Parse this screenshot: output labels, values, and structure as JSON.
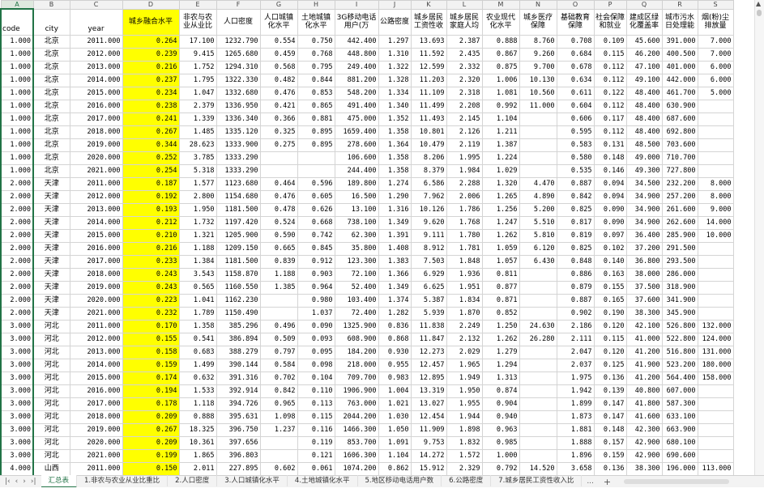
{
  "columns": [
    "A",
    "B",
    "C",
    "D",
    "E",
    "F",
    "G",
    "H",
    "I",
    "J",
    "K",
    "L",
    "M",
    "N",
    "O",
    "P",
    "Q",
    "R",
    "S"
  ],
  "headers": [
    "code",
    "city",
    "year",
    "城乡融合水平",
    "非农与农业从业比",
    "人口密度",
    "人口城镇化水平",
    "土地城镇化水平",
    "3G移动电话用户(万",
    "公路密度",
    "城乡居民工资性收",
    "城乡居民家庭人均",
    "农业现代化水平",
    "城乡医疗保障",
    "基础教育保障",
    "社会保障和就业",
    "建成区绿化覆盖率",
    "城市污水日处理能",
    "烟(粉)尘排放量"
  ],
  "rows": [
    [
      "1.000",
      "北京",
      "2011.000",
      "0.264",
      "17.100",
      "1232.790",
      "0.554",
      "0.750",
      "442.400",
      "1.297",
      "13.693",
      "2.387",
      "0.888",
      "8.760",
      "0.708",
      "0.109",
      "45.600",
      "391.000",
      "7.000"
    ],
    [
      "1.000",
      "北京",
      "2012.000",
      "0.239",
      "9.415",
      "1265.680",
      "0.459",
      "0.768",
      "448.800",
      "1.310",
      "11.592",
      "2.435",
      "0.867",
      "9.260",
      "0.684",
      "0.115",
      "46.200",
      "400.500",
      "7.000"
    ],
    [
      "1.000",
      "北京",
      "2013.000",
      "0.216",
      "1.752",
      "1294.310",
      "0.568",
      "0.795",
      "249.400",
      "1.322",
      "12.599",
      "2.332",
      "0.875",
      "9.700",
      "0.678",
      "0.112",
      "47.100",
      "401.000",
      "6.000"
    ],
    [
      "1.000",
      "北京",
      "2014.000",
      "0.237",
      "1.795",
      "1322.330",
      "0.482",
      "0.844",
      "881.200",
      "1.328",
      "11.203",
      "2.320",
      "1.006",
      "10.130",
      "0.634",
      "0.112",
      "49.100",
      "442.000",
      "6.000"
    ],
    [
      "1.000",
      "北京",
      "2015.000",
      "0.234",
      "1.047",
      "1332.680",
      "0.476",
      "0.853",
      "548.200",
      "1.334",
      "11.109",
      "2.318",
      "1.081",
      "10.560",
      "0.611",
      "0.122",
      "48.400",
      "461.700",
      "5.000"
    ],
    [
      "1.000",
      "北京",
      "2016.000",
      "0.238",
      "2.379",
      "1336.950",
      "0.421",
      "0.865",
      "491.400",
      "1.340",
      "11.499",
      "2.208",
      "0.992",
      "11.000",
      "0.604",
      "0.112",
      "48.400",
      "630.900",
      ""
    ],
    [
      "1.000",
      "北京",
      "2017.000",
      "0.241",
      "1.339",
      "1336.340",
      "0.366",
      "0.881",
      "475.000",
      "1.352",
      "11.493",
      "2.145",
      "1.104",
      "",
      "0.606",
      "0.117",
      "48.400",
      "687.600",
      ""
    ],
    [
      "1.000",
      "北京",
      "2018.000",
      "0.267",
      "1.485",
      "1335.120",
      "0.325",
      "0.895",
      "1659.400",
      "1.358",
      "10.801",
      "2.126",
      "1.211",
      "",
      "0.595",
      "0.112",
      "48.400",
      "692.800",
      ""
    ],
    [
      "1.000",
      "北京",
      "2019.000",
      "0.344",
      "28.623",
      "1333.900",
      "0.275",
      "0.895",
      "278.600",
      "1.364",
      "10.479",
      "2.119",
      "1.387",
      "",
      "0.583",
      "0.131",
      "48.500",
      "703.600",
      ""
    ],
    [
      "1.000",
      "北京",
      "2020.000",
      "0.252",
      "3.785",
      "1333.290",
      "",
      "",
      "106.600",
      "1.358",
      "8.206",
      "1.995",
      "1.224",
      "",
      "0.580",
      "0.148",
      "49.000",
      "710.700",
      ""
    ],
    [
      "1.000",
      "北京",
      "2021.000",
      "0.254",
      "5.318",
      "1333.290",
      "",
      "",
      "244.400",
      "1.358",
      "8.379",
      "1.984",
      "1.029",
      "",
      "0.535",
      "0.146",
      "49.300",
      "727.800",
      ""
    ],
    [
      "2.000",
      "天津",
      "2011.000",
      "0.187",
      "1.577",
      "1123.680",
      "0.464",
      "0.596",
      "189.800",
      "1.274",
      "6.586",
      "2.288",
      "1.320",
      "4.470",
      "0.887",
      "0.094",
      "34.500",
      "232.200",
      "8.000"
    ],
    [
      "2.000",
      "天津",
      "2012.000",
      "0.192",
      "2.800",
      "1154.680",
      "0.476",
      "0.605",
      "16.500",
      "1.290",
      "7.962",
      "2.006",
      "1.265",
      "4.890",
      "0.842",
      "0.094",
      "34.900",
      "257.200",
      "8.000"
    ],
    [
      "2.000",
      "天津",
      "2013.000",
      "0.193",
      "1.950",
      "1181.500",
      "0.478",
      "0.626",
      "13.100",
      "1.316",
      "10.126",
      "1.786",
      "1.256",
      "5.200",
      "0.825",
      "0.090",
      "34.900",
      "261.600",
      "9.000"
    ],
    [
      "2.000",
      "天津",
      "2014.000",
      "0.212",
      "1.732",
      "1197.420",
      "0.524",
      "0.668",
      "738.100",
      "1.349",
      "9.620",
      "1.768",
      "1.247",
      "5.510",
      "0.817",
      "0.090",
      "34.900",
      "262.600",
      "14.000"
    ],
    [
      "2.000",
      "天津",
      "2015.000",
      "0.210",
      "1.321",
      "1205.900",
      "0.590",
      "0.742",
      "62.300",
      "1.391",
      "9.111",
      "1.780",
      "1.262",
      "5.810",
      "0.819",
      "0.097",
      "36.400",
      "285.900",
      "10.000"
    ],
    [
      "2.000",
      "天津",
      "2016.000",
      "0.216",
      "1.188",
      "1209.150",
      "0.665",
      "0.845",
      "35.800",
      "1.408",
      "8.912",
      "1.781",
      "1.059",
      "6.120",
      "0.825",
      "0.102",
      "37.200",
      "291.500",
      ""
    ],
    [
      "2.000",
      "天津",
      "2017.000",
      "0.233",
      "1.384",
      "1181.500",
      "0.839",
      "0.912",
      "123.300",
      "1.383",
      "7.503",
      "1.848",
      "1.057",
      "6.430",
      "0.848",
      "0.140",
      "36.800",
      "293.500",
      ""
    ],
    [
      "2.000",
      "天津",
      "2018.000",
      "0.243",
      "3.543",
      "1158.870",
      "1.188",
      "0.903",
      "72.100",
      "1.366",
      "6.929",
      "1.936",
      "0.811",
      "",
      "0.886",
      "0.163",
      "38.000",
      "286.000",
      ""
    ],
    [
      "2.000",
      "天津",
      "2019.000",
      "0.243",
      "0.565",
      "1160.550",
      "1.385",
      "0.964",
      "52.400",
      "1.349",
      "6.625",
      "1.951",
      "0.877",
      "",
      "0.879",
      "0.155",
      "37.500",
      "318.900",
      ""
    ],
    [
      "2.000",
      "天津",
      "2020.000",
      "0.223",
      "1.041",
      "1162.230",
      "",
      "0.980",
      "103.400",
      "1.374",
      "5.387",
      "1.834",
      "0.871",
      "",
      "0.887",
      "0.165",
      "37.600",
      "341.900",
      ""
    ],
    [
      "2.000",
      "天津",
      "2021.000",
      "0.232",
      "1.789",
      "1150.490",
      "",
      "1.037",
      "72.400",
      "1.282",
      "5.939",
      "1.870",
      "0.852",
      "",
      "0.902",
      "0.190",
      "38.300",
      "345.900",
      ""
    ],
    [
      "3.000",
      "河北",
      "2011.000",
      "0.170",
      "1.358",
      "385.296",
      "0.496",
      "0.090",
      "1325.900",
      "0.836",
      "11.838",
      "2.249",
      "1.250",
      "24.630",
      "2.186",
      "0.120",
      "42.100",
      "526.800",
      "132.000"
    ],
    [
      "3.000",
      "河北",
      "2012.000",
      "0.155",
      "0.541",
      "386.894",
      "0.509",
      "0.093",
      "608.900",
      "0.868",
      "11.847",
      "2.132",
      "1.262",
      "26.280",
      "2.111",
      "0.115",
      "41.000",
      "522.800",
      "124.000"
    ],
    [
      "3.000",
      "河北",
      "2013.000",
      "0.158",
      "0.683",
      "388.279",
      "0.797",
      "0.095",
      "184.200",
      "0.930",
      "12.273",
      "2.029",
      "1.279",
      "",
      "2.047",
      "0.120",
      "41.200",
      "516.800",
      "131.000"
    ],
    [
      "3.000",
      "河北",
      "2014.000",
      "0.159",
      "1.499",
      "390.144",
      "0.584",
      "0.098",
      "218.000",
      "0.955",
      "12.457",
      "1.965",
      "1.294",
      "",
      "2.037",
      "0.125",
      "41.900",
      "523.200",
      "180.000"
    ],
    [
      "3.000",
      "河北",
      "2015.000",
      "0.174",
      "0.632",
      "391.316",
      "0.702",
      "0.104",
      "709.700",
      "0.983",
      "12.895",
      "1.949",
      "1.313",
      "",
      "1.975",
      "0.136",
      "41.200",
      "564.400",
      "158.000"
    ],
    [
      "3.000",
      "河北",
      "2016.000",
      "0.194",
      "1.533",
      "392.914",
      "0.842",
      "0.110",
      "1906.900",
      "1.004",
      "13.319",
      "1.950",
      "0.874",
      "",
      "1.942",
      "0.139",
      "40.800",
      "607.000",
      ""
    ],
    [
      "3.000",
      "河北",
      "2017.000",
      "0.178",
      "1.118",
      "394.726",
      "0.965",
      "0.113",
      "763.000",
      "1.021",
      "13.027",
      "1.955",
      "0.904",
      "",
      "1.899",
      "0.147",
      "41.800",
      "587.300",
      ""
    ],
    [
      "3.000",
      "河北",
      "2018.000",
      "0.209",
      "0.888",
      "395.631",
      "1.098",
      "0.115",
      "2044.200",
      "1.030",
      "12.454",
      "1.944",
      "0.940",
      "",
      "1.873",
      "0.147",
      "41.600",
      "633.100",
      ""
    ],
    [
      "3.000",
      "河北",
      "2019.000",
      "0.267",
      "18.325",
      "396.750",
      "1.237",
      "0.116",
      "1466.300",
      "1.050",
      "11.909",
      "1.898",
      "0.963",
      "",
      "1.881",
      "0.148",
      "42.300",
      "663.900",
      ""
    ],
    [
      "3.000",
      "河北",
      "2020.000",
      "0.209",
      "10.361",
      "397.656",
      "",
      "0.119",
      "853.700",
      "1.091",
      "9.753",
      "1.832",
      "0.985",
      "",
      "1.888",
      "0.157",
      "42.900",
      "680.100",
      ""
    ],
    [
      "3.000",
      "河北",
      "2021.000",
      "0.199",
      "1.865",
      "396.803",
      "",
      "0.121",
      "1606.300",
      "1.104",
      "14.272",
      "1.572",
      "1.000",
      "",
      "1.896",
      "0.159",
      "42.900",
      "690.600",
      ""
    ],
    [
      "4.000",
      "山西",
      "2011.000",
      "0.150",
      "2.011",
      "227.895",
      "0.602",
      "0.061",
      "1074.200",
      "0.862",
      "15.912",
      "2.329",
      "0.792",
      "14.520",
      "3.658",
      "0.136",
      "38.300",
      "196.000",
      "113.000"
    ],
    [
      "4.000",
      "山西",
      "2012.000",
      "0.139",
      "1.103",
      "226.999",
      "0.600",
      "0.065",
      "639.500",
      "0.882",
      "22.991",
      "2.064",
      "0.827",
      "15.390",
      "3.401",
      "0.129",
      "38.600",
      "190.100",
      "107.000"
    ],
    [
      "4.000",
      "山西",
      "2013.000",
      "0.140",
      "2.489",
      "226.168",
      "0.580",
      "0.067",
      "403.300",
      "0.892",
      "14.928",
      "2.131",
      "0.868",
      "",
      "3.094",
      "0.138",
      "40.000",
      "179.800",
      "103.000"
    ],
    [
      "4.000",
      "山西",
      "2014.000",
      "0.135",
      "1.369",
      "225.720",
      "0.611",
      "0.070",
      "505.200",
      "0.898",
      "13.247",
      "2.093",
      "0.897",
      "",
      "2.495",
      "0.146",
      "40.100",
      "208.500",
      "151.000"
    ]
  ],
  "tabs": [
    "汇总表",
    "1.非农与农业从业比重比",
    "2.人口密度",
    "3.人口城镇化水平",
    "4.土地城镇化水平",
    "5.地区移动电话用户数",
    "6.公路密度",
    "7.城乡居民工资性收入比"
  ],
  "active_tab": 0,
  "more_tabs": "…",
  "add_tab": "+",
  "highlight_color": "#ffff00",
  "accent_color": "#217346"
}
